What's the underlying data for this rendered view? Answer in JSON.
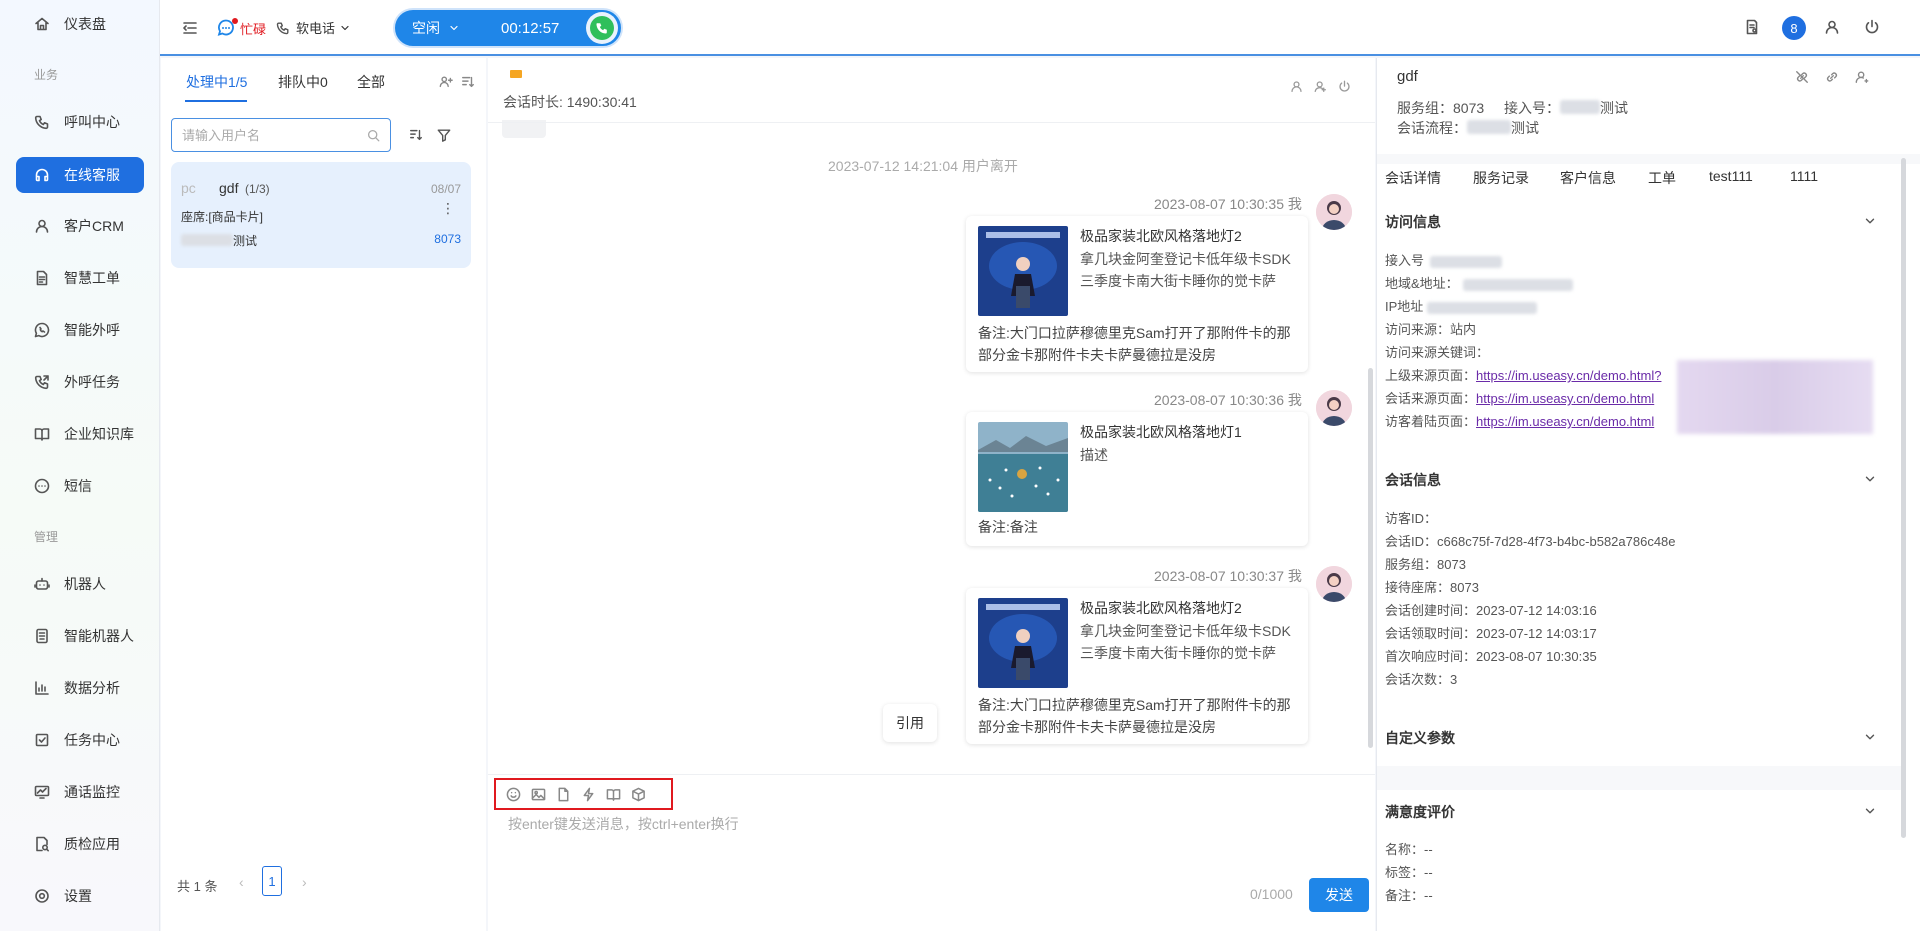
{
  "sidebar": {
    "items": [
      {
        "label": "仪表盘",
        "icon": "home-icon"
      },
      {
        "label": "呼叫中心",
        "icon": "phone-icon"
      },
      {
        "label": "在线客服",
        "icon": "headset-icon"
      },
      {
        "label": "客户CRM",
        "icon": "user-icon"
      },
      {
        "label": "智慧工单",
        "icon": "document-icon"
      },
      {
        "label": "智能外呼",
        "icon": "chat-phone-icon"
      },
      {
        "label": "外呼任务",
        "icon": "phone-out-icon"
      },
      {
        "label": "企业知识库",
        "icon": "book-icon"
      },
      {
        "label": "短信",
        "icon": "sms-icon"
      },
      {
        "label": "机器人",
        "icon": "robot-icon"
      },
      {
        "label": "智能机器人",
        "icon": "smart-robot-icon"
      },
      {
        "label": "数据分析",
        "icon": "bar-chart-icon"
      },
      {
        "label": "任务中心",
        "icon": "task-icon"
      },
      {
        "label": "通话监控",
        "icon": "monitor-icon"
      },
      {
        "label": "质检应用",
        "icon": "inspect-icon"
      },
      {
        "label": "设置",
        "icon": "gear-icon"
      }
    ],
    "groups": {
      "business": "业务",
      "manage": "管理"
    }
  },
  "topbar": {
    "busy_label": "忙碌",
    "phone_label": "软电话",
    "call_status": "空闲",
    "call_timer": "00:12:57",
    "notification_count": "8"
  },
  "list": {
    "tabs": [
      "处理中1/5",
      "排队中0",
      "全部"
    ],
    "search_placeholder": "请输入用户名",
    "card": {
      "avatar_text": "pc",
      "name": "gdf",
      "count": "(1/3)",
      "date": "08/07",
      "seat": "座席:[商品卡片]",
      "sub_suffix": "测试",
      "group": "8073"
    },
    "pager": {
      "total": "共 1 条",
      "page": "1"
    }
  },
  "chat": {
    "duration": "会话时长: 1490:30:41",
    "leave_notice": "2023-07-12 14:21:04 用户离开",
    "messages": [
      {
        "time": "2023-08-07 10:30:35 我",
        "title": "极品家装北欧风格落地灯2",
        "desc": "拿几块金阿奎登记卡低年级卡SDK三季度卡南大街卡睡你的觉卡萨",
        "note": "备注:大门口拉萨穆德里克Sam打开了那附件卡的那部分金卡那附件卡夫卡萨曼德拉是没房",
        "thumb": "presenter"
      },
      {
        "time": "2023-08-07 10:30:36 我",
        "title": "极品家装北欧风格落地灯1",
        "desc": "描述",
        "note": "备注:备注",
        "thumb": "lake"
      },
      {
        "time": "2023-08-07 10:30:37 我",
        "title": "极品家装北欧风格落地灯2",
        "desc": "拿几块金阿奎登记卡低年级卡SDK三季度卡南大街卡睡你的觉卡萨",
        "note": "备注:大门口拉萨穆德里克Sam打开了那附件卡的那部分金卡那附件卡夫卡萨曼德拉是没房",
        "thumb": "presenter"
      }
    ],
    "quote_label": "引用",
    "input_placeholder": "按enter键发送消息，按ctrl+enter换行",
    "char_count": "0/1000",
    "send_label": "发送"
  },
  "right": {
    "name": "gdf",
    "service_group": "服务组：8073",
    "access_no": "接入号：",
    "access_suffix": "测试",
    "flow": "会话流程：",
    "flow_suffix": "测试",
    "tabs": [
      "会话详情",
      "服务记录",
      "客户信息",
      "工单",
      "test111",
      "1111"
    ],
    "visit": {
      "title": "访问信息",
      "access_no": "接入号",
      "region": "地域&地址：",
      "ip": "IP地址",
      "source": "访问来源：站内",
      "keyword": "访问来源关键词：",
      "prev_page_label": "上级来源页面：",
      "prev_page_url": "https://im.useasy.cn/demo.html?",
      "session_page_label": "会话来源页面：",
      "session_page_url": "https://im.useasy.cn/demo.html",
      "landing_page_label": "访客着陆页面：",
      "landing_page_url": "https://im.useasy.cn/demo.html"
    },
    "session": {
      "title": "会话信息",
      "visitor_id": "访客ID：",
      "session_id": "会话ID：c668c75f-7d28-4f73-b4bc-b582a786c48e",
      "group": "服务组：8073",
      "seat": "接待座席：8073",
      "created": "会话创建时间：2023-07-12 14:03:16",
      "claimed": "会话领取时间：2023-07-12 14:03:17",
      "first_response": "首次响应时间：2023-08-07 10:30:35",
      "count": "会话次数：3"
    },
    "custom_title": "自定义参数",
    "satisfaction": {
      "title": "满意度评价",
      "name": "名称：--",
      "tag": "标签：--",
      "note": "备注：--"
    }
  },
  "colors": {
    "primary": "#1f6fe0",
    "send": "#1f86e8",
    "highlight": "#e0191f",
    "busy": "#e0191f",
    "call_green": "#2fbf5b"
  }
}
